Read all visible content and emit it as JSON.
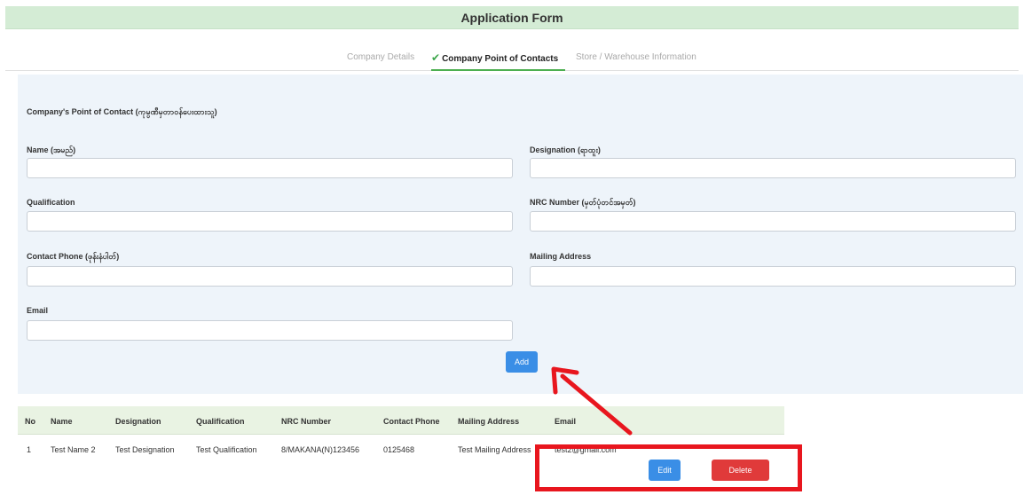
{
  "header": {
    "title": "Application Form"
  },
  "tabs": [
    {
      "label": "Company Details",
      "state": "inactive"
    },
    {
      "label": "Company Point of Contacts",
      "state": "active",
      "icon": "check-icon"
    },
    {
      "label": "Store / Warehouse Information",
      "state": "inactive"
    }
  ],
  "form": {
    "section_title": "Company's Point of Contact (ကုမ္ပဏီမှတာဝန်ပေးထားသူ)",
    "fields": {
      "name": {
        "label": "Name (အမည်)",
        "value": ""
      },
      "designation": {
        "label": "Designation (ရာထူး)",
        "value": ""
      },
      "qualification": {
        "label": "Qualification",
        "value": ""
      },
      "nrc": {
        "label": "NRC Number (မှတ်ပုံတင်အမှတ်)",
        "value": ""
      },
      "phone": {
        "label": "Contact Phone (ဖုန်းနံပါတ်)",
        "value": ""
      },
      "mailing": {
        "label": "Mailing Address",
        "value": ""
      },
      "email": {
        "label": "Email",
        "value": ""
      }
    },
    "add_label": "Add"
  },
  "table": {
    "headers": [
      "No",
      "Name",
      "Designation",
      "Qualification",
      "NRC Number",
      "Contact Phone",
      "Mailing Address",
      "Email"
    ],
    "rows": [
      {
        "no": "1",
        "name": "Test Name 2",
        "designation": "Test Designation",
        "qualification": "Test Qualification",
        "nrc": "8/MAKANA(N)123456",
        "phone": "0125468",
        "mailing": "Test Mailing Address",
        "email": "test2@gmail.com",
        "edit_label": "Edit",
        "delete_label": "Delete"
      }
    ]
  },
  "colors": {
    "header_bg": "#d4ecd5",
    "active_tab_underline": "#4caf50",
    "form_panel_bg": "#eef4fa",
    "primary_button": "#3a8ee6",
    "danger_button": "#e03a3a",
    "annotation_red": "#e8161e"
  }
}
